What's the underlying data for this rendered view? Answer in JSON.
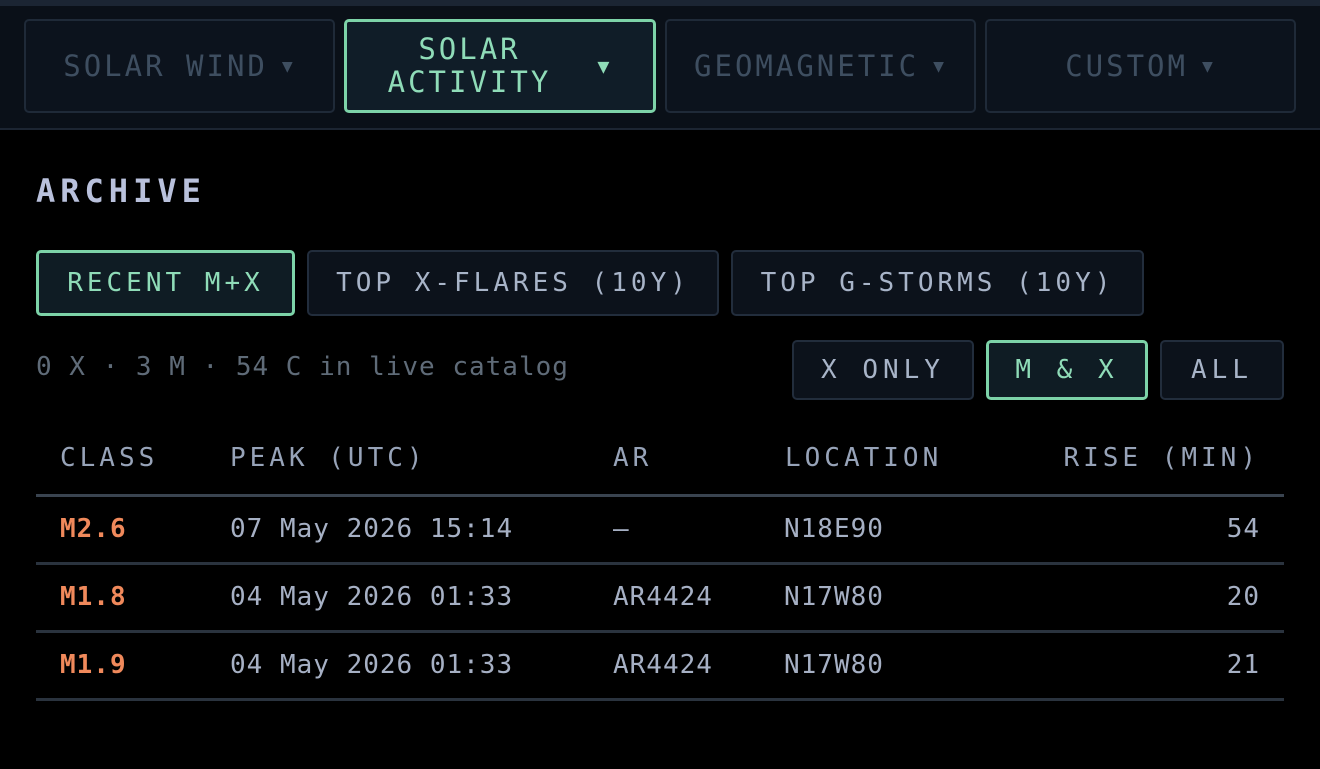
{
  "tabs": [
    {
      "label": "SOLAR WIND",
      "caret": "▼",
      "active": false
    },
    {
      "label": "SOLAR ACTIVITY",
      "line1": "SOLAR",
      "line2": "ACTIVITY",
      "caret": "▼",
      "active": true
    },
    {
      "label": "GEOMAGNETIC",
      "caret": "▼",
      "active": false
    },
    {
      "label": "CUSTOM",
      "caret": "▼",
      "active": false
    }
  ],
  "archive": {
    "title": "ARCHIVE",
    "presets": [
      {
        "label": "RECENT M+X",
        "active": true
      },
      {
        "label": "TOP X-FLARES (10Y)",
        "active": false
      },
      {
        "label": "TOP G-STORMS (10Y)",
        "active": false
      }
    ],
    "summary": "0 X · 3 M · 54 C in live catalog",
    "filters": [
      {
        "label": "X ONLY",
        "active": false
      },
      {
        "label": "M & X",
        "active": true
      },
      {
        "label": "ALL",
        "active": false
      }
    ],
    "columns": [
      "CLASS",
      "PEAK (UTC)",
      "AR",
      "LOCATION",
      "RISE (MIN)"
    ],
    "rows": [
      {
        "class": "M2.6",
        "peak": "07 May 2026 15:14",
        "ar": "—",
        "location": "N18E90",
        "rise": "54"
      },
      {
        "class": "M1.8",
        "peak": "04 May 2026 01:33",
        "ar": "AR4424",
        "location": "N17W80",
        "rise": "20"
      },
      {
        "class": "M1.9",
        "peak": "04 May 2026 01:33",
        "ar": "AR4424",
        "location": "N17W80",
        "rise": "21"
      }
    ]
  },
  "colors": {
    "accent": "#7dd3a8",
    "flare_class": "#f0895b",
    "background": "#000000"
  }
}
